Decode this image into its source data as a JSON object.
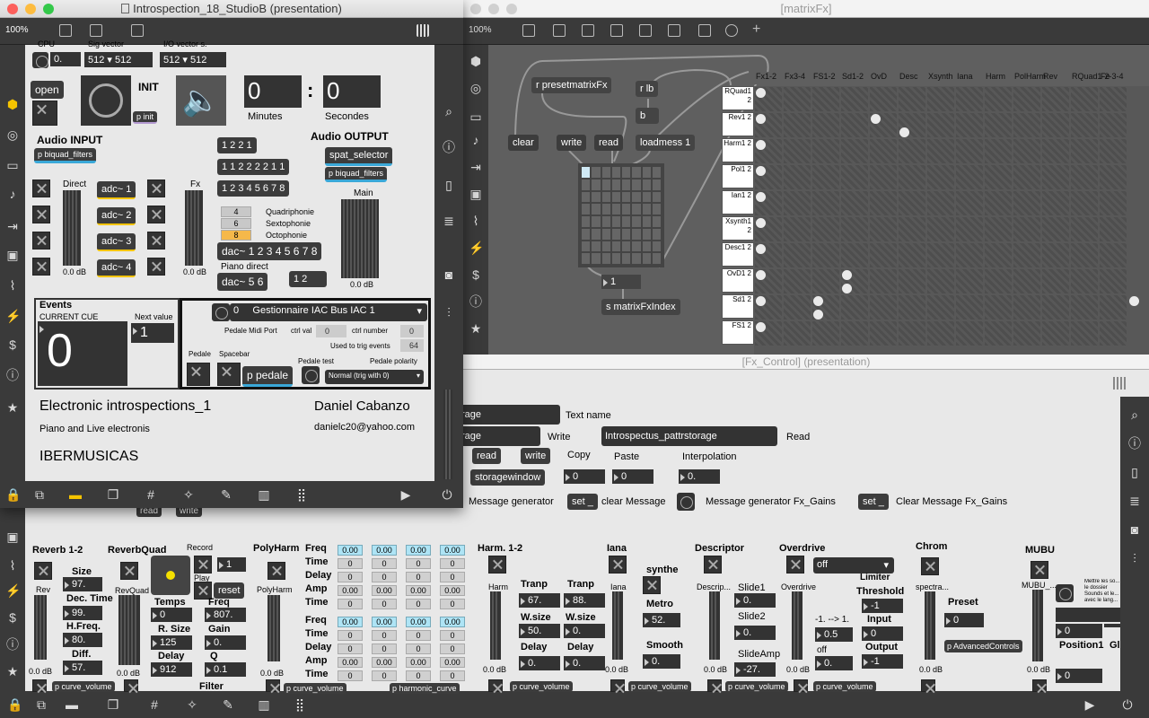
{
  "win_main": {
    "title": "Introspection_18_StudioB (presentation)",
    "zoom": "100%"
  },
  "win_matrix": {
    "title": "[matrixFx]",
    "zoom": "100%"
  },
  "win_fx": {
    "title": "[Fx_Control] (presentation)"
  },
  "main": {
    "cpu_label": "CPU",
    "cpu_val": "0.",
    "sig_label": "Sig vector",
    "sig_val1": "512",
    "sig_val2": "512",
    "io_label": "I/O vector s.",
    "io_val1": "512",
    "io_val2": "512",
    "open": "open",
    "init": "INIT",
    "p_init": "p init",
    "minutes_val": "0",
    "minutes_label": "Minutes",
    "colon": ":",
    "seconds_val": "0",
    "seconds_label": "Secondes",
    "audio_input": "Audio INPUT",
    "p_biquad_in": "p biquad_filters",
    "direct": "Direct",
    "fx": "Fx",
    "adcs": [
      "adc~ 1",
      "adc~ 2",
      "adc~ 3",
      "adc~ 4"
    ],
    "db1": "0.0 dB",
    "db2": "0.0 dB",
    "db3": "0.0 dB",
    "msgs": [
      "1 2 2 1",
      "1 1 2 2 2 2 1 1",
      "1 2 3 4 5 6 7 8"
    ],
    "opts": [
      {
        "n": "4",
        "l": "Quadriphonie"
      },
      {
        "n": "6",
        "l": "Sextophonie"
      },
      {
        "n": "8",
        "l": "Octophonie"
      }
    ],
    "dac8": "dac~ 1 2 3 4 5 6 7 8",
    "piano_direct": "Piano direct",
    "dac56": "dac~ 5 6",
    "m12": "1 2",
    "audio_output": "Audio OUTPUT",
    "spat": "spat_selector",
    "p_biquad_out": "p biquad_filters",
    "main_label": "Main",
    "events": "Events",
    "current_cue": "CURRENT CUE",
    "cue_val": "0",
    "next_value": "Next value",
    "next_val": "1",
    "iac_num": "0",
    "iac": "Gestionnaire IAC Bus IAC 1",
    "pedale_midi": "Pedale Midi Port",
    "ctrl_val": "ctrl val",
    "ctrl_val_v": "0",
    "ctrl_number": "ctrl number",
    "ctrl_number_v": "0",
    "used": "Used to trig events",
    "used_v": "64",
    "pedale": "Pedale",
    "spacebar": "Spacebar",
    "pedale_test": "Pedale test",
    "pedale_polarity": "Pedale polarity",
    "p_pedale": "p pedale",
    "normal": "Normal (trig with 0)",
    "title": "Electronic introspections_1",
    "subtitle": "Piano and Live electronis",
    "author": "Daniel Cabanzo",
    "email": "danielc20@yahoo.com",
    "org": "IBERMUSICAS"
  },
  "matrix": {
    "r_preset": "r presetmatrixFx",
    "r_lb": "r lb",
    "b": "b",
    "loadmess": "loadmess 1",
    "clear": "clear",
    "write": "write",
    "read": "read",
    "num1": "1",
    "s_index": "s matrixFxIndex",
    "cols": [
      "Fx1-2",
      "Fx3-4",
      "FS1-2",
      "Sd1-2",
      "OvD",
      "Desc",
      "Xsynth",
      "Iana",
      "Harm",
      "PolHarm",
      "Rev",
      "RQuad1-2-3-4",
      "Fe"
    ],
    "rows": [
      [
        "RQuad1",
        "2"
      ],
      [
        "Rev1",
        "2"
      ],
      [
        "Harm1",
        "2"
      ],
      [
        "Pol1",
        "2"
      ],
      [
        "Ian1",
        "2"
      ],
      [
        "Xsynth1",
        "2"
      ],
      [
        "Desc1",
        "2"
      ],
      [
        "OvD1",
        "2"
      ],
      [
        "Sd1",
        "2"
      ],
      [
        "FS1",
        "2"
      ]
    ]
  },
  "fx": {
    "storage1": "rage",
    "text_name": "Text name",
    "storage2": "rage",
    "write_l": "Write",
    "pattr": "Introspectus_pattrstorage",
    "read_l": "Read",
    "read": "read",
    "write": "write",
    "copy": "Copy",
    "paste": "Paste",
    "interp": "Interpolation",
    "storagewindow": "storagewindow",
    "copy_v": "0",
    "paste_v": "0",
    "interp_v": "0.",
    "msg_gen": "Message generator",
    "set1": "set _",
    "clear_msg": "clear Message",
    "msg_gen_gains": "Message generator Fx_Gains",
    "set2": "set _",
    "clear_gains": "Clear Message Fx_Gains",
    "read_b": "read",
    "write_b": "write",
    "reverb": "Reverb 1-2",
    "reverbquad": "ReverbQuad",
    "record": "Record",
    "play": "Play",
    "reset": "reset",
    "rec_v": "1",
    "size": "Size",
    "size_v": "97.",
    "dectime": "Dec. Time",
    "dectime_v": "99.",
    "hfreq": "H.Freq.",
    "hfreq_v": "80.",
    "diff": "Diff.",
    "diff_v": "57.",
    "rev": "Rev",
    "revquad": "RevQuad",
    "temps": "Temps",
    "temps_v": "0",
    "rsize": "R. Size",
    "rsize_v": "125",
    "delay": "Delay",
    "delay_v": "912",
    "freq": "Freq",
    "freq_v": "807.",
    "gain": "Gain",
    "gain_v": "0.",
    "q": "Q",
    "q_v": "0.1",
    "filter": "Filter",
    "polyharm": "PolyHarm",
    "polyharm2": "PolyHarm",
    "ph_labels": [
      "Freq",
      "Time",
      "Delay",
      "Amp",
      "Time",
      "Freq",
      "Time",
      "Delay",
      "Amp",
      "Time"
    ],
    "ph_rows": [
      [
        "0.00",
        "0.00",
        "0.00",
        "0.00"
      ],
      [
        "0",
        "0",
        "0",
        "0"
      ],
      [
        "0",
        "0",
        "0",
        "0"
      ],
      [
        "0.00",
        "0.00",
        "0.00",
        "0.00"
      ],
      [
        "0",
        "0",
        "0",
        "0"
      ],
      [
        "0.00",
        "0.00",
        "0.00",
        "0.00"
      ],
      [
        "0",
        "0",
        "0",
        "0"
      ],
      [
        "0",
        "0",
        "0",
        "0"
      ],
      [
        "0.00",
        "0.00",
        "0.00",
        "0.00"
      ],
      [
        "0",
        "0",
        "0",
        "0"
      ]
    ],
    "harm": "Harm. 1-2",
    "harm_s": "Harm",
    "tranp": "Tranp",
    "tranp1": "67.",
    "tranp2": "88.",
    "wsize": "W.size",
    "wsize1": "50.",
    "wsize2": "0.",
    "hdelay": "Delay",
    "hdelay1": "0.",
    "hdelay2": "0.",
    "iana": "Iana",
    "iana_s": "Iana",
    "synthe": "synthe",
    "metro": "Metro",
    "metro_v": "52.",
    "smooth": "Smooth",
    "smooth_v": "0.",
    "descriptor": "Descriptor",
    "descr_s": "Descrip...",
    "slide1": "Slide1",
    "slide1_v": "0.",
    "slide2": "Slide2",
    "slide2_v": "0.",
    "slideamp": "SlideAmp",
    "slideamp_v": "-27.",
    "overdrive": "Overdrive",
    "overdrive_s": "Overdrive",
    "off": "off",
    "range": "-1. --> 1.",
    "range_v": "0.5",
    "off2": "off",
    "off2_v": "0.",
    "limiter": "Limiter",
    "threshold": "Threshold",
    "thr_v": "-1",
    "input": "Input",
    "input_v": "0",
    "output": "Output",
    "output_v": "-1",
    "chrom": "Chrom",
    "spectra": "spectra...",
    "preset": "Preset",
    "preset_v": "0",
    "p_adv": "p AdvancedControls",
    "mubu": "MUBU",
    "mubu_s": "MUBU_...",
    "position1": "Position1",
    "pos_v1": "0",
    "pos_v2": "0",
    "note": "Mettre les so... le dossier Sounds et le... avec le lang...",
    "gl": "Gl",
    "pcurve": "p curve_volume",
    "pharmony": "p harmonic_curve",
    "db": "0.0 dB"
  }
}
